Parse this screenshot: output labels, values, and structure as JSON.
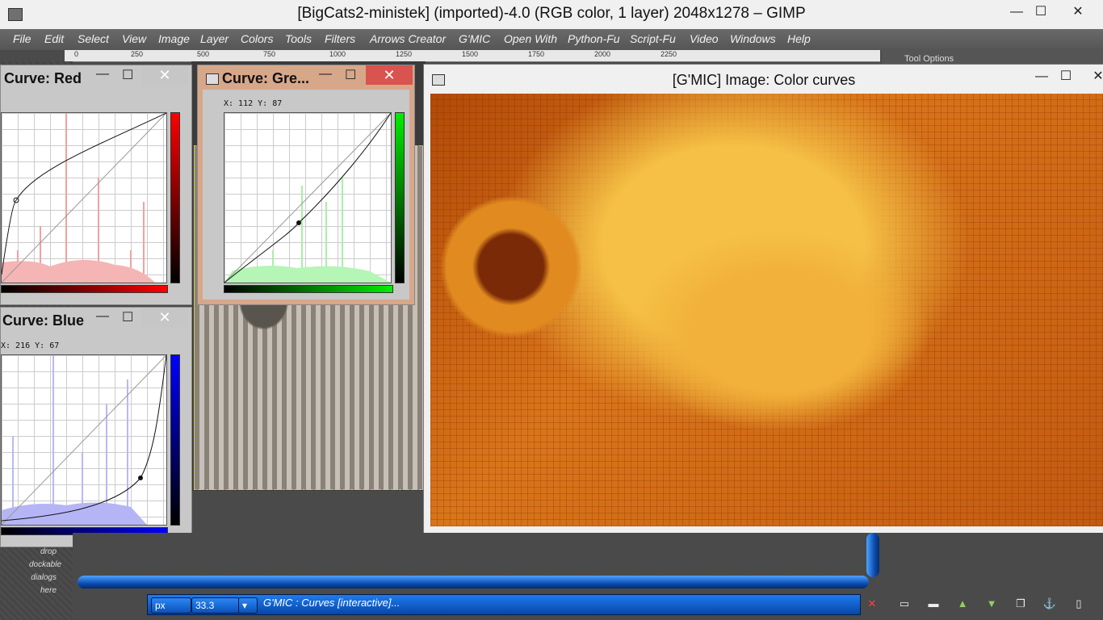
{
  "window": {
    "title": "[BigCats2-ministek] (imported)-4.0 (RGB color, 1 layer) 2048x1278 – GIMP",
    "minimize": "—",
    "maximize": "☐",
    "close": "✕"
  },
  "menu": [
    "File",
    "Edit",
    "Select",
    "View",
    "Image",
    "Layer",
    "Colors",
    "Tools",
    "Filters",
    "Arrows Creator",
    "G'MIC",
    "Open With",
    "Python-Fu",
    "Script-Fu",
    "Video",
    "Windows",
    "Help"
  ],
  "ruler": {
    "ticks": [
      "0",
      "250",
      "500",
      "750",
      "1000",
      "1250",
      "1500",
      "1750",
      "2000",
      "2250"
    ]
  },
  "tool_options": {
    "label": "Tool Options"
  },
  "panels": {
    "red": {
      "title": "Curve: Red",
      "coords": "",
      "min": "—",
      "max": "☐",
      "close": "✕",
      "color": "#ff0000"
    },
    "green": {
      "title": "Curve: Gre...",
      "coords": "X: 112  Y: 87",
      "min": "—",
      "max": "☐",
      "close": "✕",
      "color": "#00dd00"
    },
    "blue": {
      "title": "Curve: Blue",
      "coords": "X: 216  Y: 67",
      "min": "—",
      "max": "☐",
      "close": "✕",
      "color": "#0000ff"
    }
  },
  "gmic": {
    "title": "[G'MIC] Image: Color curves",
    "min": "—",
    "max": "☐",
    "close": "✕"
  },
  "dock_hint": [
    "drop",
    "dockable",
    "dialogs",
    "here"
  ],
  "status": {
    "unit": "px",
    "zoom": "33.3",
    "message": "G'MIC : Curves [interactive]..."
  },
  "colors": {
    "accent": "#0c4fb4",
    "panel_red_close": "#d9534f"
  }
}
